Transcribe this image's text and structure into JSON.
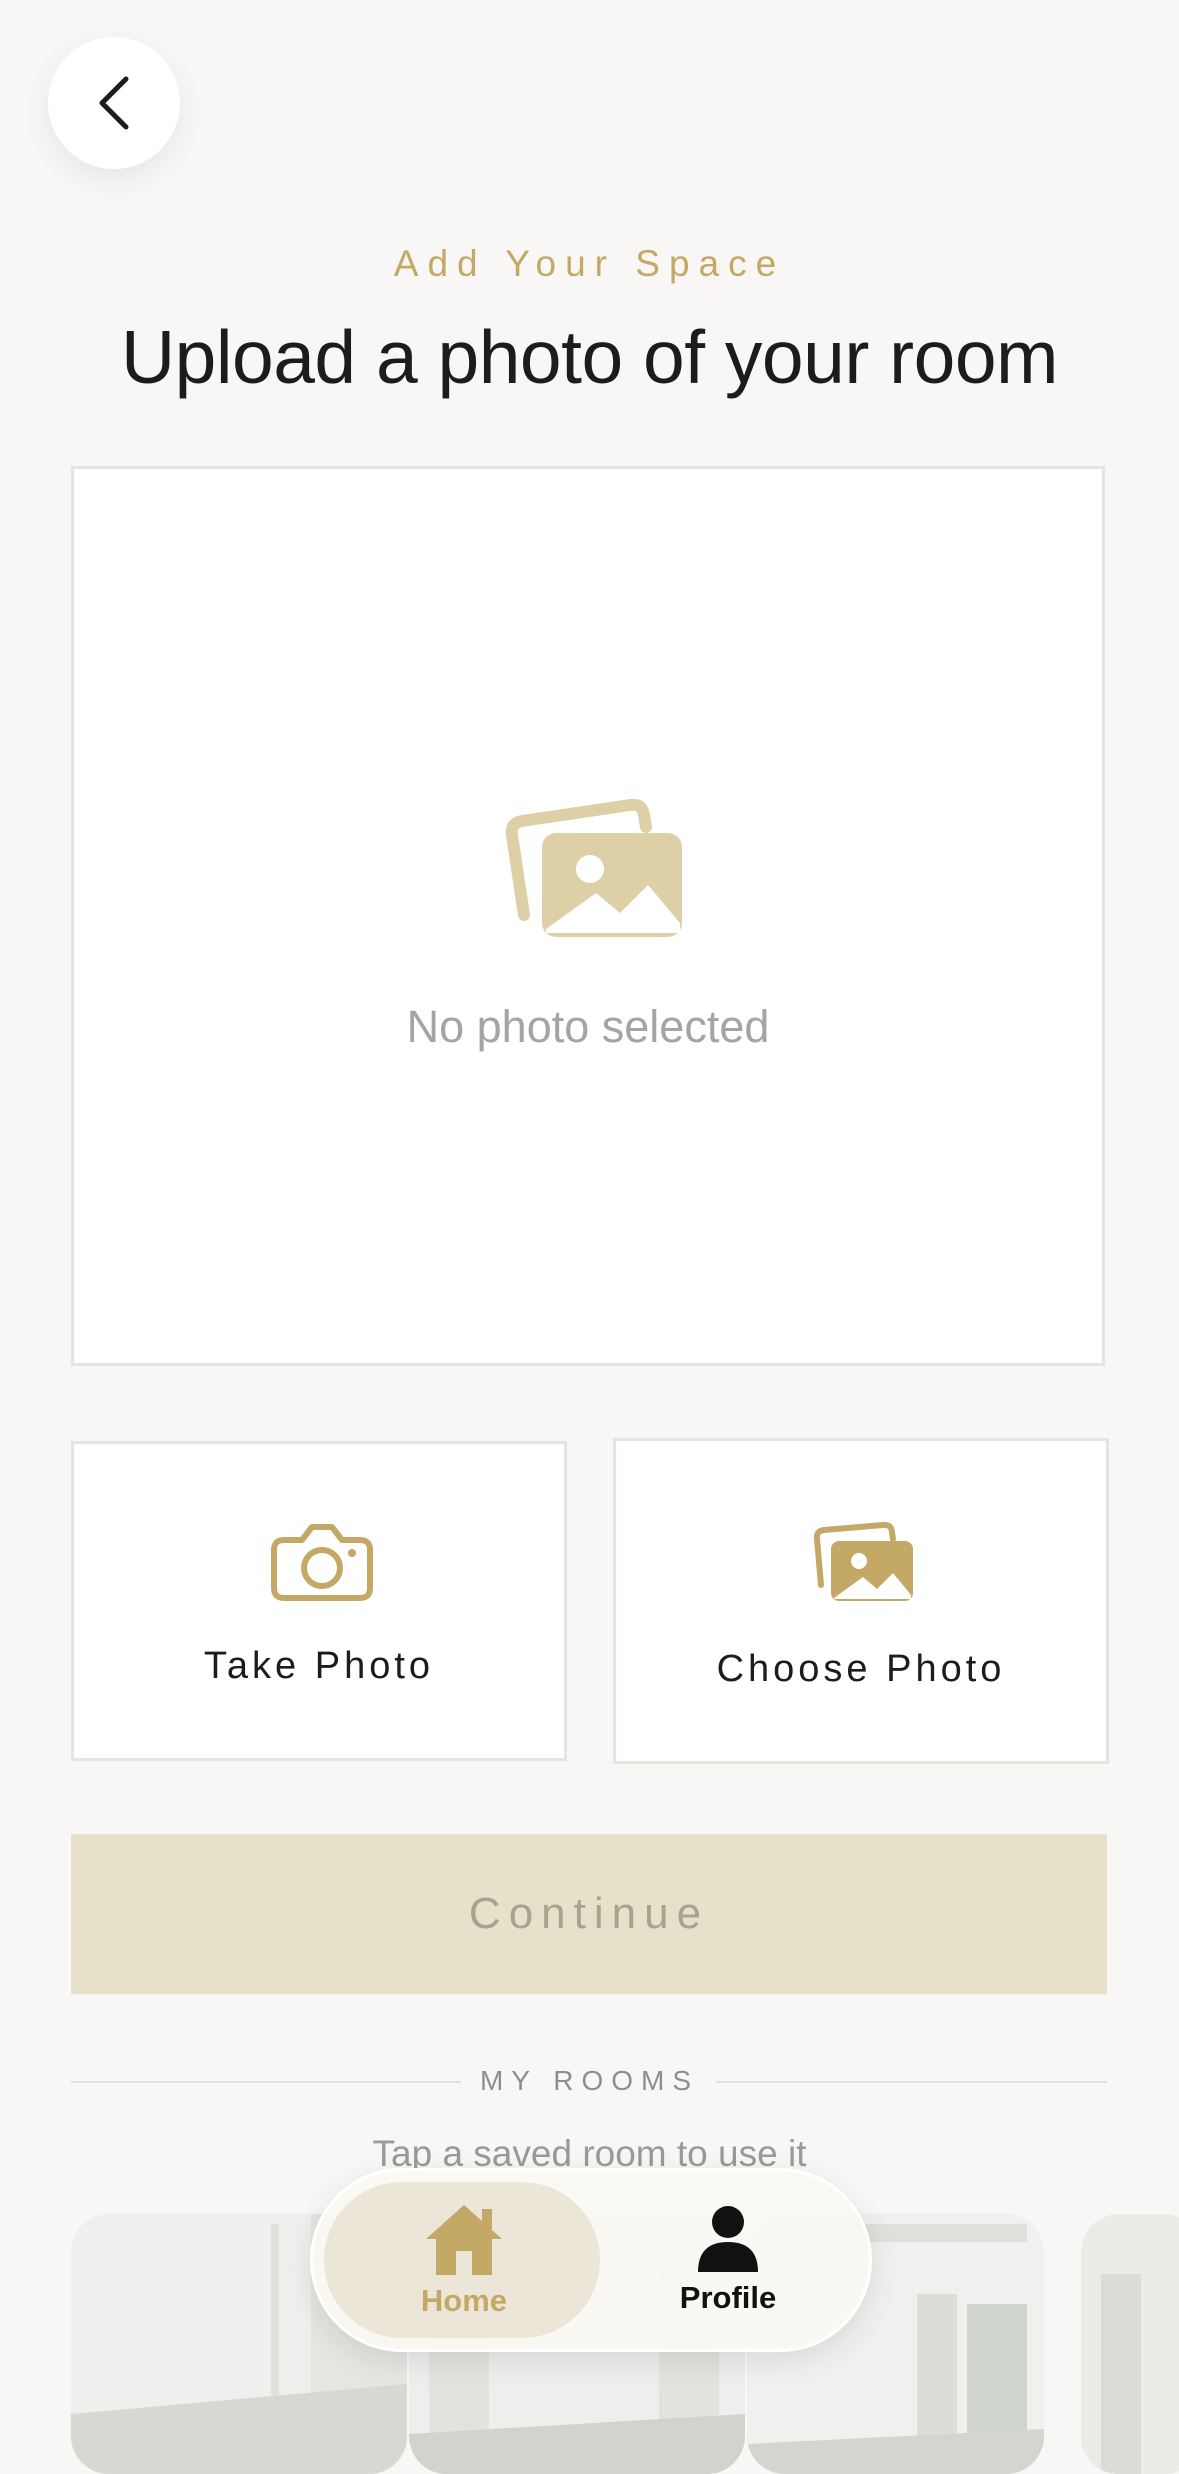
{
  "header": {
    "eyebrow": "Add Your Space",
    "title": "Upload a photo of your room"
  },
  "preview": {
    "empty_text": "No photo selected",
    "icon": "photos-icon"
  },
  "actions": {
    "take_photo": {
      "label": "Take Photo",
      "icon": "camera-icon"
    },
    "choose_photo": {
      "label": "Choose Photo",
      "icon": "photos-icon"
    }
  },
  "continue": {
    "label": "Continue",
    "enabled": false
  },
  "my_rooms": {
    "title": "MY ROOMS",
    "hint": "Tap a saved room to use it"
  },
  "tabbar": {
    "items": [
      {
        "label": "Home",
        "icon": "home-icon",
        "active": true
      },
      {
        "label": "Profile",
        "icon": "person-icon",
        "active": false
      }
    ]
  },
  "colors": {
    "accent": "#c4a966",
    "accent_light": "#ddd0a6",
    "background": "#f8f7f5",
    "continue_disabled_bg": "#e8e1c9",
    "continue_disabled_text": "#a8a290"
  }
}
